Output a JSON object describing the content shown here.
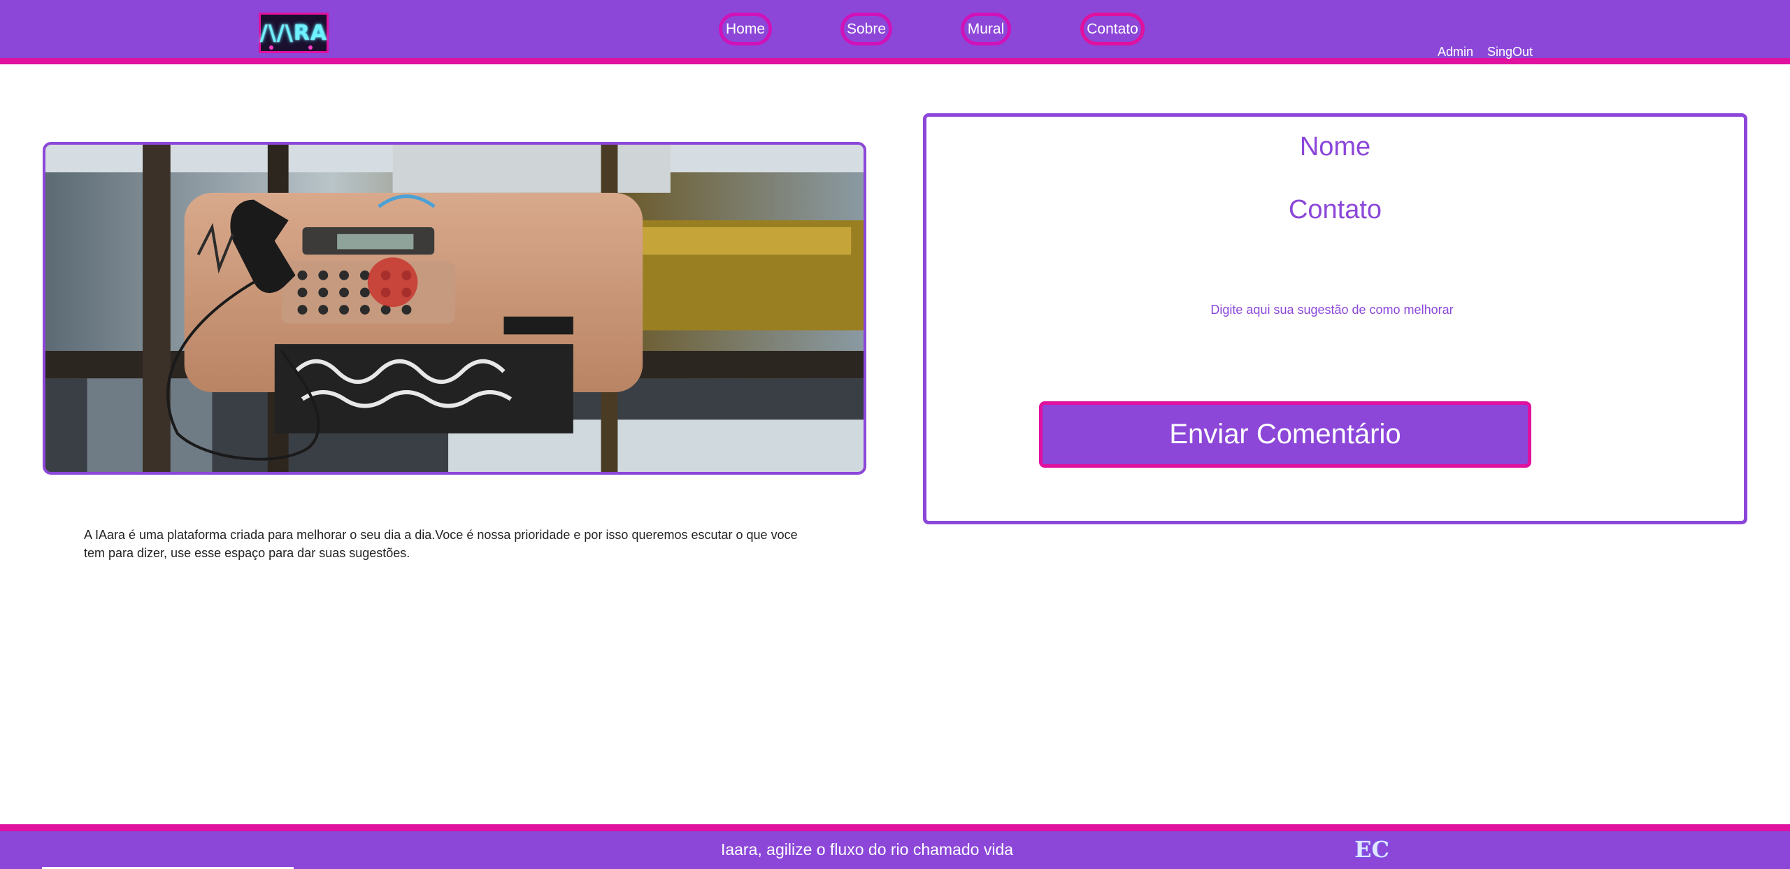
{
  "header": {
    "logo_text": "/\\/\\RA",
    "nav": {
      "home": "Home",
      "sobre": "Sobre",
      "mural": "Mural",
      "contato": "Contato"
    },
    "admin": "Admin",
    "signout": "SingOut"
  },
  "main": {
    "about_text": "A IAara é uma plataforma criada para melhorar o seu dia a dia.Voce é nossa prioridade e por isso queremos escutar o que voce tem para dizer, use esse espaço para dar suas sugestões."
  },
  "form": {
    "nome_label": "Nome",
    "contato_label": "Contato",
    "suggestion_placeholder": "Digite aqui sua sugestão de como melhorar",
    "submit_label": "Enviar Comentário"
  },
  "footer": {
    "tagline": "Iaara, agilize o fluxo do rio chamado vida",
    "logo_text": "EC"
  },
  "colors": {
    "brand_purple": "#8c47d9",
    "accent_pink": "#e0119e"
  }
}
